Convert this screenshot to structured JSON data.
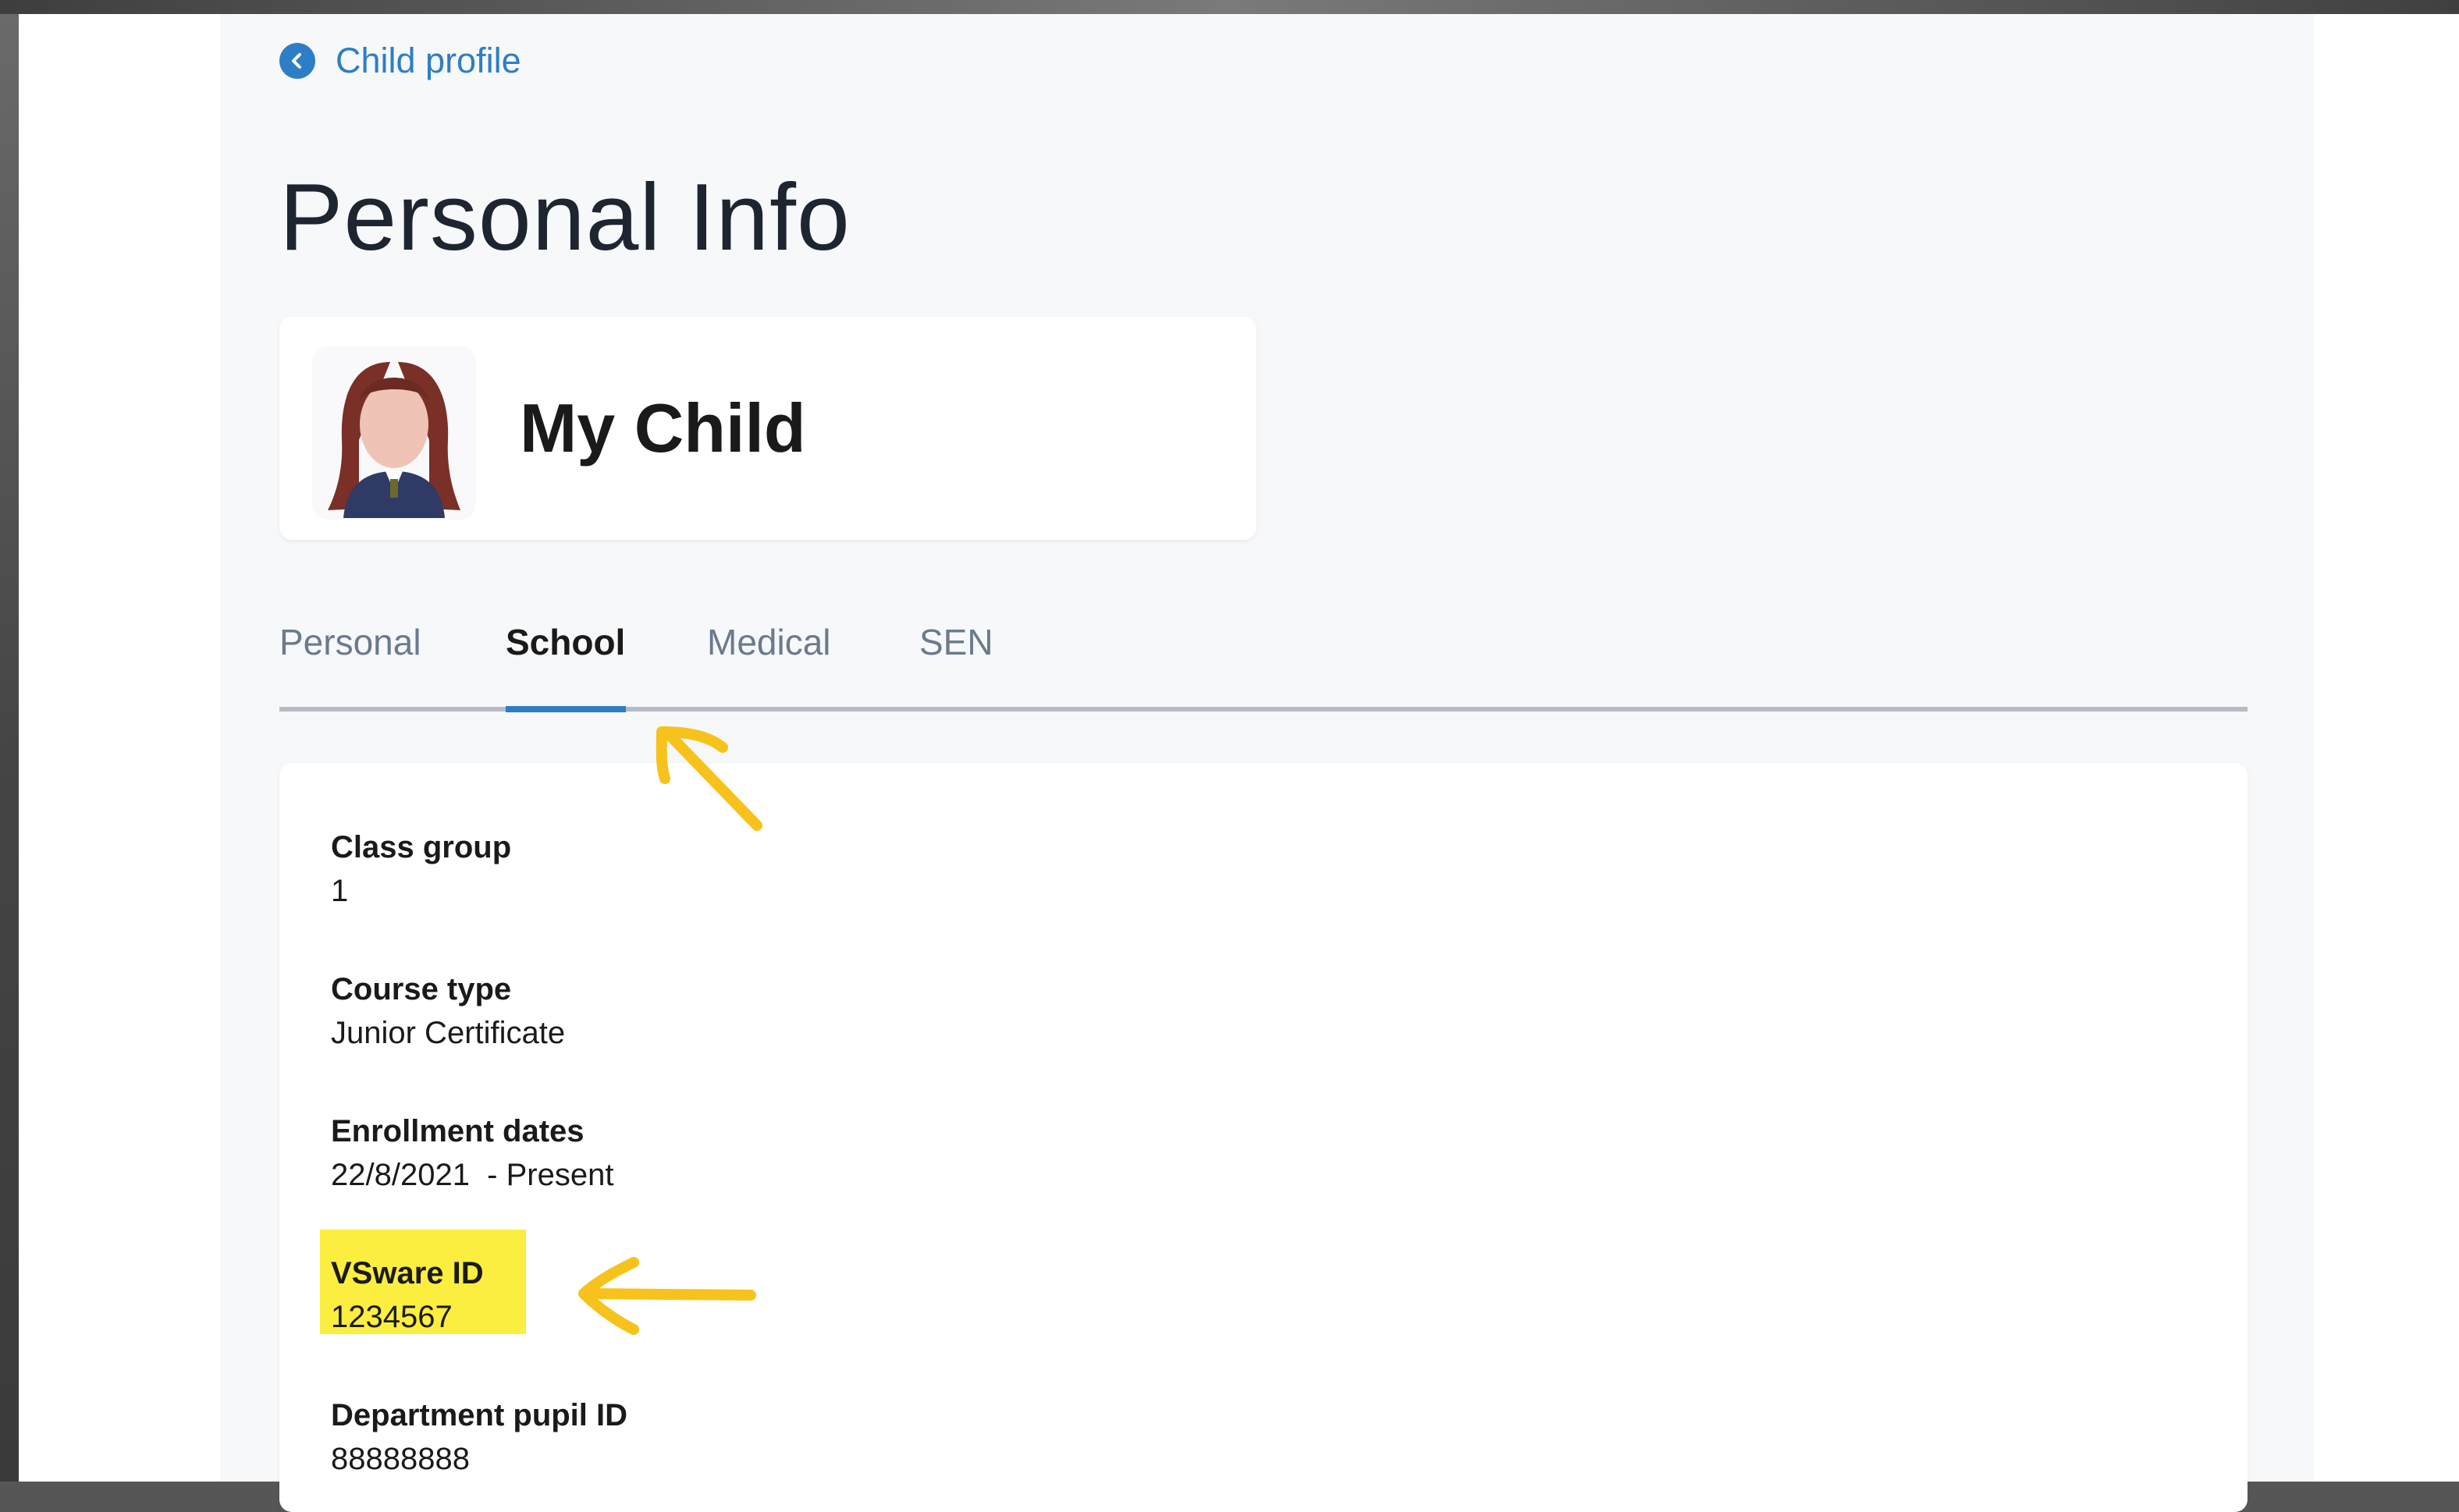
{
  "nav": {
    "back_label": "Child profile"
  },
  "page": {
    "title": "Personal Info"
  },
  "profile": {
    "name": "My Child"
  },
  "tabs": [
    {
      "label": "Personal",
      "active": false
    },
    {
      "label": "School",
      "active": true
    },
    {
      "label": "Medical",
      "active": false
    },
    {
      "label": "SEN",
      "active": false
    }
  ],
  "school_info": {
    "fields": [
      {
        "label": "Class group",
        "value": "1"
      },
      {
        "label": "Course type",
        "value": "Junior Certificate"
      },
      {
        "label": "Enrollment dates",
        "value": "22/8/2021  - Present"
      },
      {
        "label": "VSware ID",
        "value": "1234567",
        "highlighted": true
      },
      {
        "label": "Department pupil ID",
        "value": "88888888"
      }
    ]
  },
  "colors": {
    "accent": "#2d7ec6",
    "highlight": "#fbee3f",
    "annotation_arrow": "#f7c21b"
  }
}
